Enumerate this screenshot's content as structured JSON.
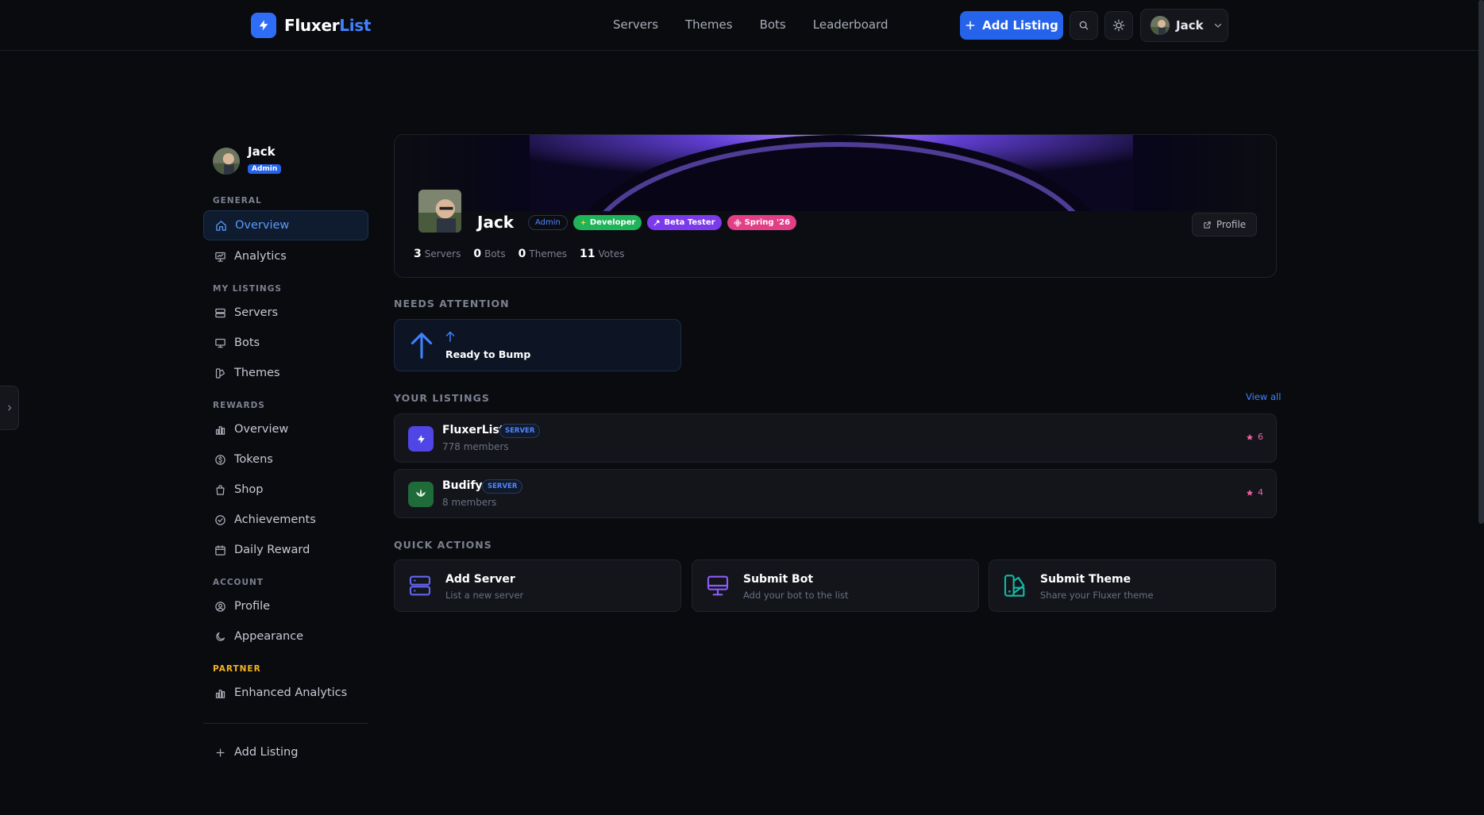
{
  "brand": {
    "name_part1": "Fluxer",
    "name_part2": "List",
    "accent_color": "#2f6df6"
  },
  "nav": {
    "links": [
      "Servers",
      "Themes",
      "Bots",
      "Leaderboard"
    ],
    "add_listing": "Add Listing",
    "user_name": "Jack"
  },
  "sidebar": {
    "user_name": "Jack",
    "role_badge": "Admin",
    "sections": {
      "general": "GENERAL",
      "my_listings": "MY LISTINGS",
      "rewards": "REWARDS",
      "account": "ACCOUNT",
      "partner": "PARTNER"
    },
    "items": {
      "overview": "Overview",
      "analytics": "Analytics",
      "servers": "Servers",
      "bots": "Bots",
      "themes": "Themes",
      "rewards_overview": "Overview",
      "tokens": "Tokens",
      "shop": "Shop",
      "achievements": "Achievements",
      "daily_reward": "Daily Reward",
      "profile": "Profile",
      "appearance": "Appearance",
      "enhanced_analytics": "Enhanced Analytics",
      "add_listing": "Add Listing"
    }
  },
  "profile": {
    "name": "Jack",
    "badges": [
      "Admin",
      "Developer",
      "Beta Tester",
      "Spring '26"
    ],
    "profile_button": "Profile",
    "stats": [
      {
        "value": "3",
        "label": "Servers"
      },
      {
        "value": "0",
        "label": "Bots"
      },
      {
        "value": "0",
        "label": "Themes"
      },
      {
        "value": "11",
        "label": "Votes"
      }
    ]
  },
  "needs_attention": {
    "title": "NEEDS ATTENTION",
    "item": "Ready to Bump"
  },
  "your_listings": {
    "title": "YOUR LISTINGS",
    "view_all": "View all",
    "rows": [
      {
        "name": "FluxerList",
        "tag": "SERVER",
        "sub": "778 members",
        "votes": "6"
      },
      {
        "name": "Budify",
        "tag": "SERVER",
        "sub": "8 members",
        "votes": "4"
      }
    ]
  },
  "quick_actions": {
    "title": "QUICK ACTIONS",
    "items": [
      {
        "title": "Add Server",
        "sub": "List a new server",
        "icon": "server-icon"
      },
      {
        "title": "Submit Bot",
        "sub": "Add your bot to the list",
        "icon": "monitor-icon"
      },
      {
        "title": "Submit Theme",
        "sub": "Share your Fluxer theme",
        "icon": "palette-icon"
      }
    ]
  },
  "colors": {
    "primary": "#2563eb",
    "developer": "#1fb35a",
    "beta": "#7c3aed",
    "spring": "#e23f86",
    "partner": "#f5b325"
  }
}
